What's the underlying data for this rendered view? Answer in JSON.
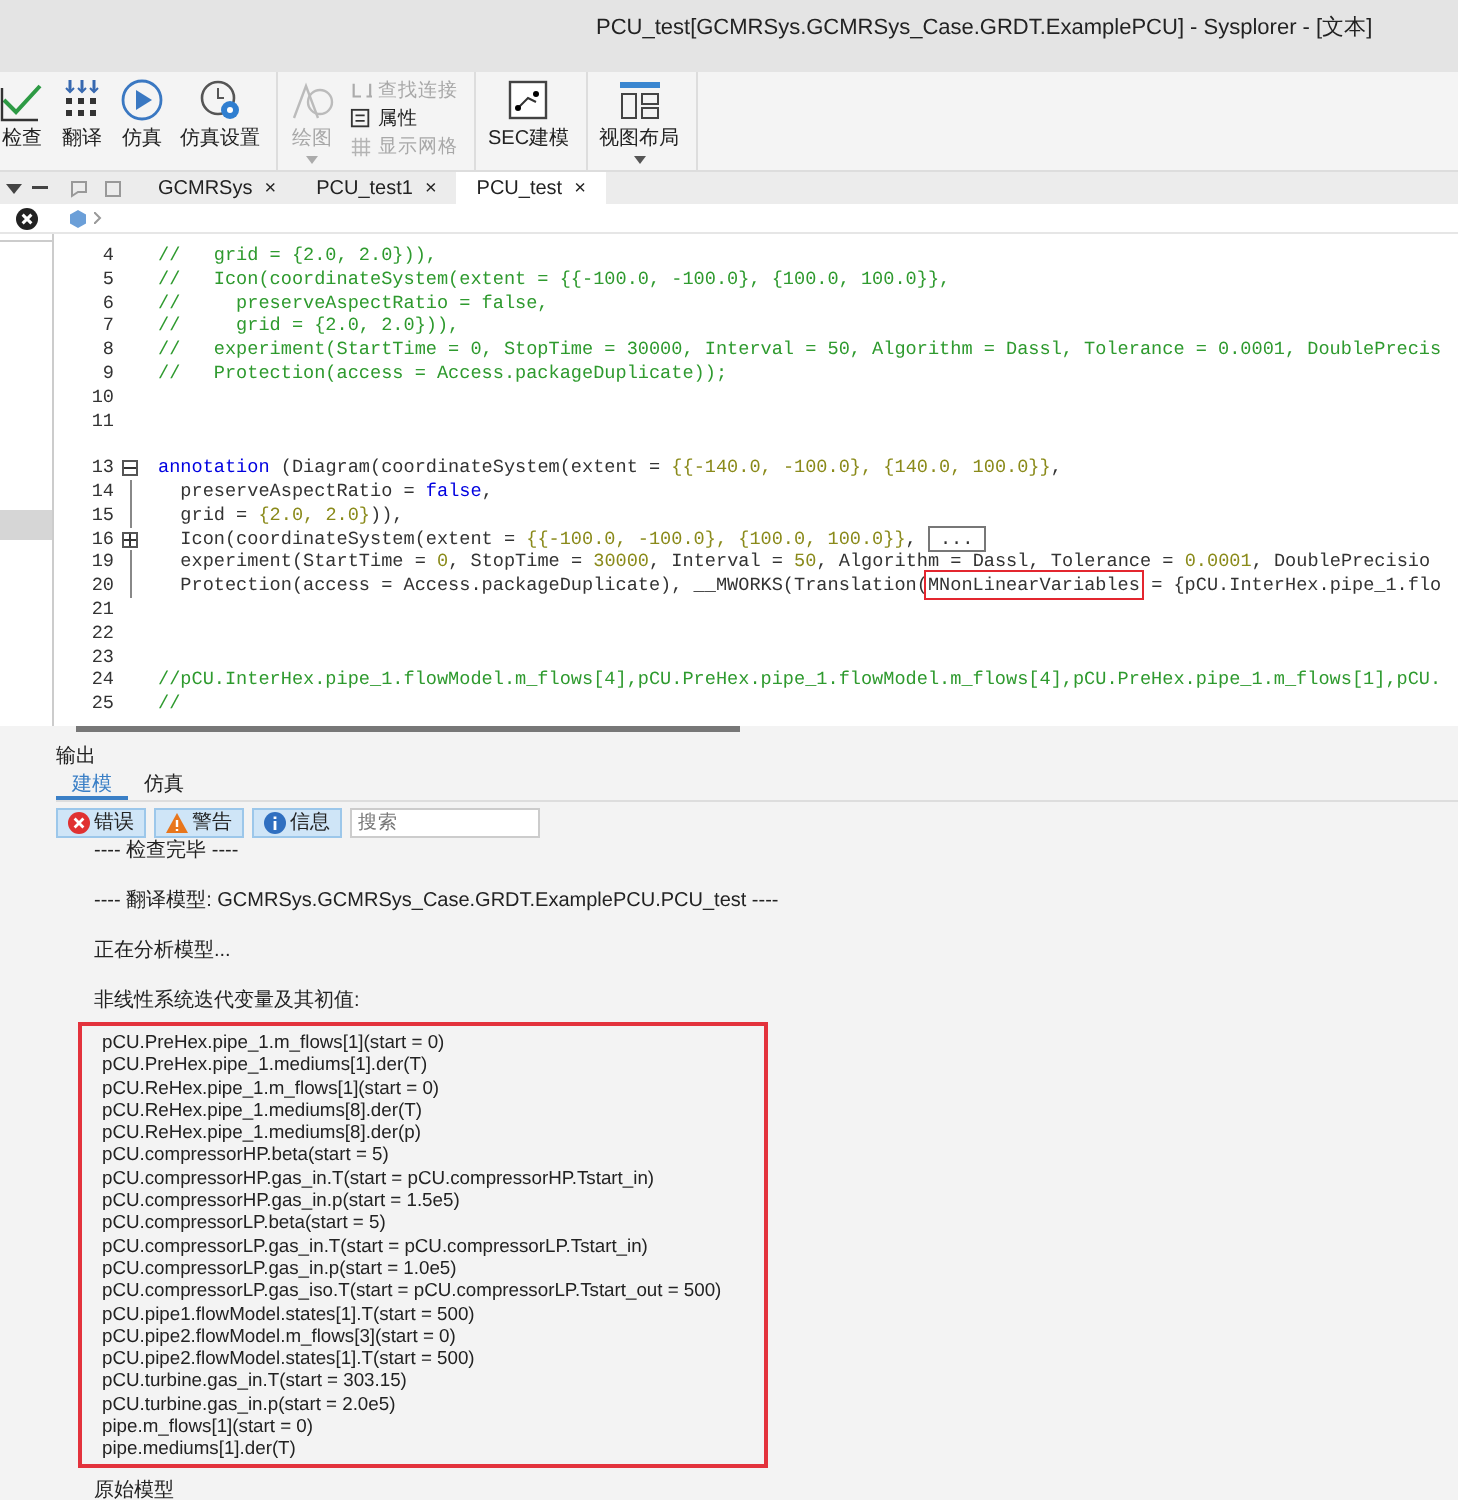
{
  "window": {
    "title": "PCU_test[GCMRSys.GCMRSys_Case.GRDT.ExamplePCU] - Sysplorer - [文本]"
  },
  "ribbon": {
    "groups": [
      {
        "items": [
          {
            "label": "检查",
            "kind": "large",
            "disabled": false,
            "menu": false
          },
          {
            "label": "翻译",
            "kind": "large",
            "disabled": false,
            "menu": false
          },
          {
            "label": "仿真",
            "kind": "large",
            "disabled": false,
            "menu": false
          },
          {
            "label": "仿真设置",
            "kind": "large",
            "disabled": false,
            "menu": false
          }
        ]
      },
      {
        "items": [
          {
            "label": "绘图",
            "kind": "large",
            "disabled": true,
            "menu": true
          },
          {
            "label": "查找连接",
            "kind": "small",
            "disabled": true
          },
          {
            "label": "属性",
            "kind": "small",
            "disabled": false
          },
          {
            "label": "显示网格",
            "kind": "small",
            "disabled": true
          }
        ]
      },
      {
        "items": [
          {
            "label": "SEC建模",
            "kind": "large",
            "disabled": false,
            "menu": false
          }
        ]
      },
      {
        "items": [
          {
            "label": "视图布局",
            "kind": "large",
            "disabled": false,
            "menu": true
          }
        ]
      }
    ]
  },
  "editor_tabs": [
    {
      "label": "GCMRSys",
      "close": "×",
      "selected": false
    },
    {
      "label": "PCU_test1",
      "close": "×",
      "selected": false
    },
    {
      "label": "PCU_test",
      "close": "×",
      "selected": true
    }
  ],
  "code_lines": [
    {
      "kind": "code",
      "number": "4",
      "segments": [
        {
          "kind": "comment",
          "t": "//   grid = {2.0, 2.0})),"
        }
      ]
    },
    {
      "kind": "code",
      "number": "5",
      "segments": [
        {
          "kind": "comment",
          "t": "//   Icon(coordinateSystem(extent = {{-100.0, -100.0}, {100.0, 100.0}},"
        }
      ]
    },
    {
      "kind": "code",
      "number": "6",
      "segments": [
        {
          "kind": "comment",
          "t": "//     preserveAspectRatio = false,"
        }
      ]
    },
    {
      "kind": "code",
      "number": "7",
      "segments": [
        {
          "kind": "comment",
          "t": "//     grid = {2.0, 2.0})),"
        }
      ]
    },
    {
      "kind": "code",
      "number": "8",
      "segments": [
        {
          "kind": "comment",
          "t": "//   experiment(StartTime = 0, StopTime = 30000, Interval = 50, Algorithm = Dassl, Tolerance = 0.0001, DoublePrecis"
        }
      ]
    },
    {
      "kind": "code",
      "number": "9",
      "segments": [
        {
          "kind": "comment",
          "t": "//   Protection(access = Access.packageDuplicate));"
        }
      ]
    },
    {
      "kind": "code",
      "number": "10"
    },
    {
      "kind": "code",
      "number": "11"
    },
    {
      "kind": "gap"
    },
    {
      "kind": "code",
      "number": "13",
      "fold": {
        "expanded": true
      },
      "segments": [
        {
          "kind": "keyword",
          "t": "annotation"
        },
        {
          "kind": "plain",
          "t": " (Diagram(coordinateSystem(extent = "
        },
        {
          "kind": "number",
          "t": "{{-140.0, -100.0}, {140.0, 100.0}}"
        },
        {
          "kind": "plain",
          "t": ","
        }
      ]
    },
    {
      "kind": "code",
      "number": "14",
      "in_fold": true,
      "segments": [
        {
          "kind": "plain",
          "t": "  preserveAspectRatio = "
        },
        {
          "kind": "keyword",
          "t": "false"
        },
        {
          "kind": "plain",
          "t": ","
        }
      ]
    },
    {
      "kind": "code",
      "number": "15",
      "in_fold": true,
      "segments": [
        {
          "kind": "plain",
          "t": "  grid = "
        },
        {
          "kind": "number",
          "t": "{2.0, 2.0}"
        },
        {
          "kind": "plain",
          "t": ")),"
        }
      ]
    },
    {
      "kind": "code",
      "number": "16",
      "fold": {
        "expanded": false
      },
      "segments": [
        {
          "kind": "plain",
          "t": "  Icon(coordinateSystem(extent = "
        },
        {
          "kind": "number",
          "t": "{{-100.0, -100.0}, {100.0, 100.0}}"
        },
        {
          "kind": "plain",
          "t": ", "
        },
        {
          "kind": "folded",
          "t": "..."
        }
      ]
    },
    {
      "kind": "code",
      "number": "19",
      "in_fold": true,
      "segments": [
        {
          "kind": "plain",
          "t": "  experiment(StartTime = "
        },
        {
          "kind": "number",
          "t": "0"
        },
        {
          "kind": "plain",
          "t": ", StopTime = "
        },
        {
          "kind": "number",
          "t": "30000"
        },
        {
          "kind": "plain",
          "t": ", Interval = "
        },
        {
          "kind": "number",
          "t": "50"
        },
        {
          "kind": "plain",
          "t": ", Algorithm = Dassl, Tolerance = "
        },
        {
          "kind": "number",
          "t": "0.0001"
        },
        {
          "kind": "plain",
          "t": ", DoublePrecisio"
        }
      ]
    },
    {
      "kind": "code",
      "number": "20",
      "in_fold": true,
      "segments": [
        {
          "kind": "plain",
          "t": "  Protection(access = Access.packageDuplicate), __MWORKS(Translation("
        },
        {
          "kind": "marked",
          "t": "MNonLinearVariables"
        },
        {
          "kind": "plain",
          "t": " = {pCU.InterHex.pipe_1.flo"
        }
      ]
    },
    {
      "kind": "code",
      "number": "21"
    },
    {
      "kind": "code",
      "number": "22"
    },
    {
      "kind": "code",
      "number": "23"
    },
    {
      "kind": "code",
      "number": "24",
      "segments": [
        {
          "kind": "comment",
          "t": "//pCU.InterHex.pipe_1.flowModel.m_flows[4],pCU.PreHex.pipe_1.flowModel.m_flows[4],pCU.PreHex.pipe_1.m_flows[1],pCU."
        }
      ]
    },
    {
      "kind": "code",
      "number": "25",
      "segments": [
        {
          "kind": "comment",
          "t": "//"
        }
      ]
    }
  ],
  "output": {
    "title": "输出",
    "tabs": [
      {
        "label": "建模",
        "selected": true
      },
      {
        "label": "仿真",
        "selected": false
      }
    ],
    "filters": [
      {
        "label": "错误",
        "kind": "error",
        "selected": true
      },
      {
        "label": "警告",
        "kind": "warning",
        "selected": true
      },
      {
        "label": "信息",
        "kind": "info",
        "selected": true
      }
    ],
    "search": {
      "placeholder": "搜索"
    },
    "log": [
      {
        "kind": "text",
        "text": "---- 检查完毕 ----"
      },
      {
        "kind": "text",
        "text": "---- 翻译模型: GCMRSys.GCMRSys_Case.GRDT.ExamplePCU.PCU_test ----"
      },
      {
        "kind": "text",
        "text": "正在分析模型..."
      },
      {
        "kind": "text",
        "text": "非线性系统迭代变量及其初值:"
      },
      {
        "kind": "boxed",
        "lines": [
          "pCU.PreHex.pipe_1.m_flows[1](start = 0)",
          "pCU.PreHex.pipe_1.mediums[1].der(T)",
          "pCU.ReHex.pipe_1.m_flows[1](start = 0)",
          "pCU.ReHex.pipe_1.mediums[8].der(T)",
          "pCU.ReHex.pipe_1.mediums[8].der(p)",
          "pCU.compressorHP.beta(start = 5)",
          "pCU.compressorHP.gas_in.T(start = pCU.compressorHP.Tstart_in)",
          "pCU.compressorHP.gas_in.p(start = 1.5e5)",
          "pCU.compressorLP.beta(start = 5)",
          "pCU.compressorLP.gas_in.T(start = pCU.compressorLP.Tstart_in)",
          "pCU.compressorLP.gas_in.p(start = 1.0e5)",
          "pCU.compressorLP.gas_iso.T(start = pCU.compressorLP.Tstart_out = 500)",
          "pCU.pipe1.flowModel.states[1].T(start = 500)",
          "pCU.pipe2.flowModel.m_flows[3](start = 0)",
          "pCU.pipe2.flowModel.states[1].T(start = 500)",
          "pCU.turbine.gas_in.T(start = 303.15)",
          "pCU.turbine.gas_in.p(start = 2.0e5)",
          "pipe.m_flows[1](start = 0)",
          "pipe.mediums[1].der(T)"
        ]
      },
      {
        "kind": "text",
        "text": "原始模型"
      }
    ]
  }
}
